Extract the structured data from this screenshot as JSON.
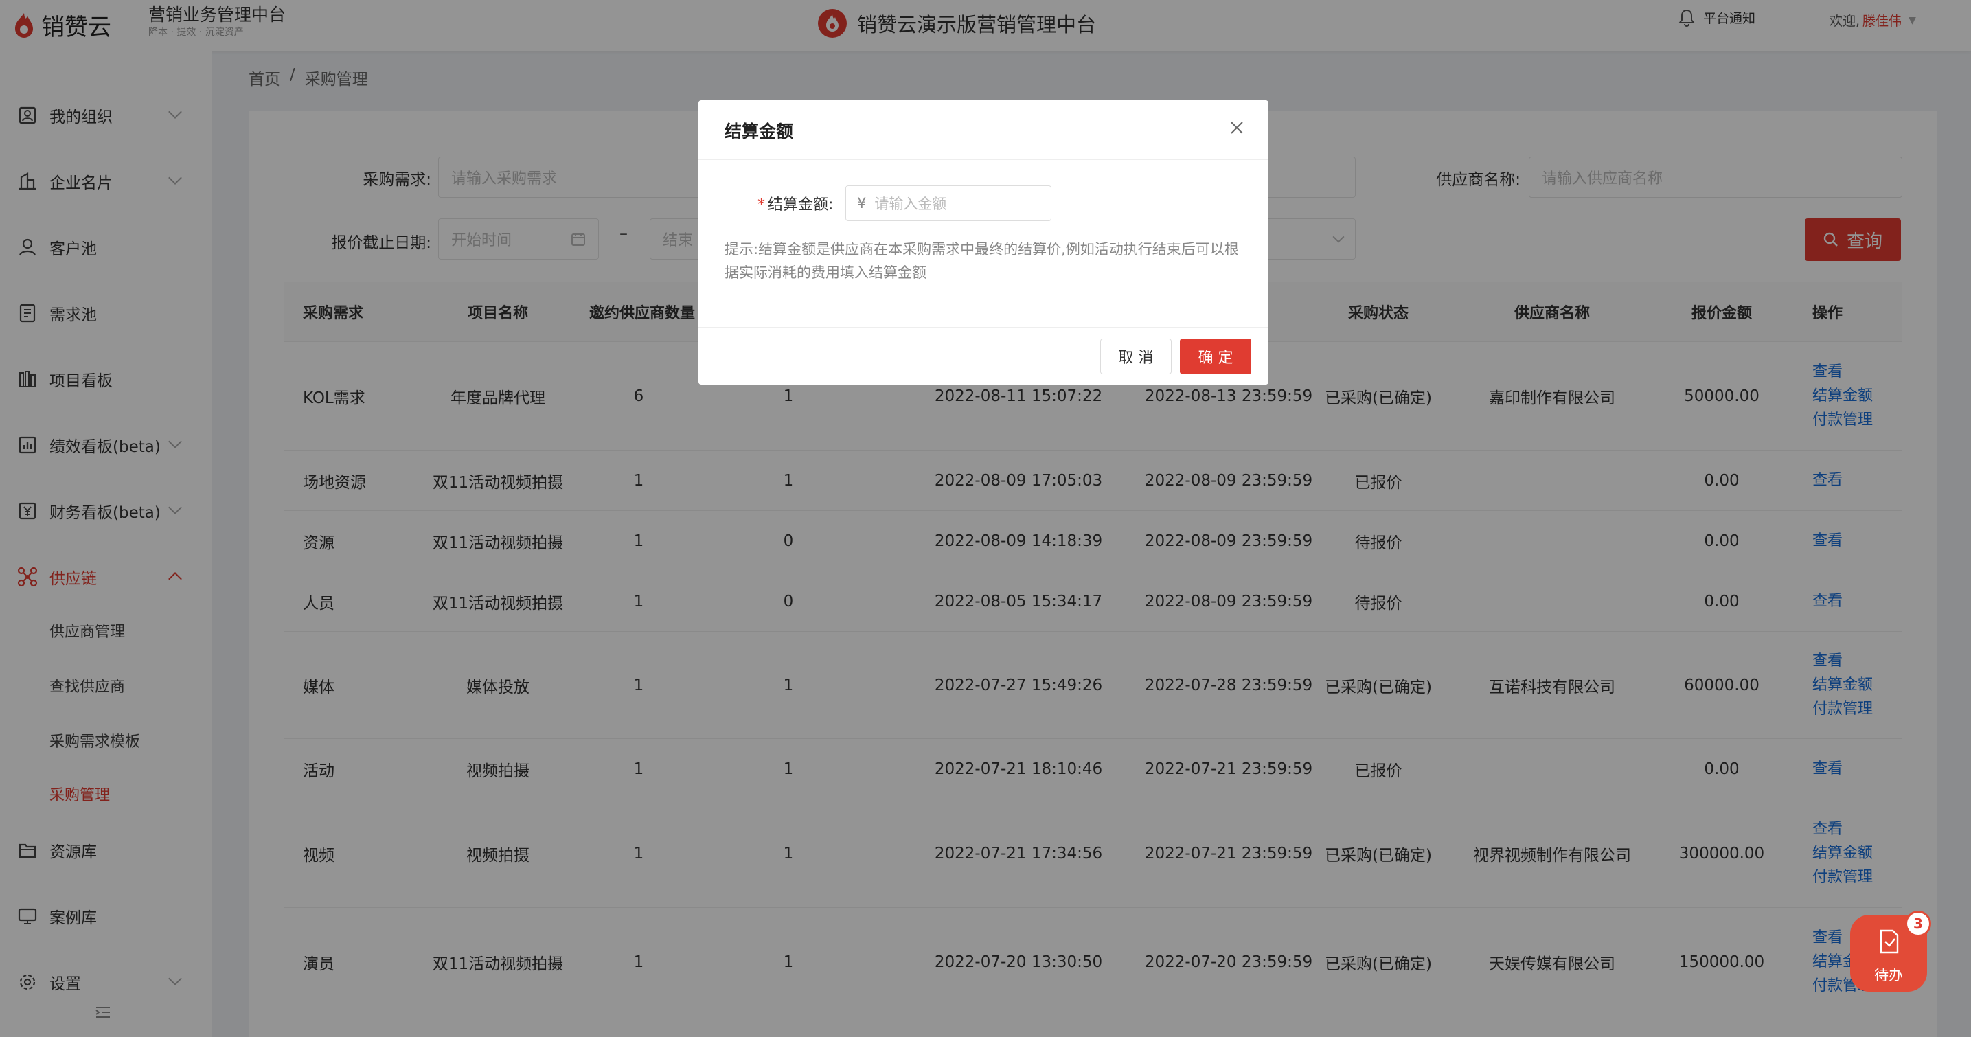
{
  "header": {
    "logo_text": "销赞云",
    "subtitle": "营销业务管理中台",
    "tagline": "降本 · 提效 · 沉淀资产",
    "center_title": "销赞云演示版营销管理中台",
    "notify_label": "平台通知",
    "welcome": "欢迎,",
    "user": "滕佳伟"
  },
  "sidebar": {
    "items": [
      {
        "label": "我的组织",
        "icon": "org-icon"
      },
      {
        "label": "企业名片",
        "icon": "building-icon"
      },
      {
        "label": "客户池",
        "icon": "user-icon"
      },
      {
        "label": "需求池",
        "icon": "list-icon"
      },
      {
        "label": "项目看板",
        "icon": "board-icon"
      },
      {
        "label": "绩效看板(beta)",
        "icon": "chart-icon"
      },
      {
        "label": "财务看板(beta)",
        "icon": "yen-icon"
      },
      {
        "label": "供应链",
        "icon": "supply-chain-icon"
      },
      {
        "label": "资源库",
        "icon": "folder-icon"
      },
      {
        "label": "案例库",
        "icon": "monitor-icon"
      },
      {
        "label": "设置",
        "icon": "gear-icon"
      }
    ],
    "sub_items": [
      "供应商管理",
      "查找供应商",
      "采购需求模板",
      "采购管理"
    ]
  },
  "breadcrumb": {
    "home": "首页",
    "sep": "/",
    "current": "采购管理"
  },
  "filters": {
    "demand_label": "采购需求:",
    "demand_placeholder": "请输入采购需求",
    "supplier_label": "供应商名称:",
    "supplier_placeholder": "请输入供应商名称",
    "date_label": "报价截止日期:",
    "start_placeholder": "开始时间",
    "end_placeholder": "结束",
    "dash": "–",
    "query": "查询"
  },
  "table": {
    "columns": [
      "采购需求",
      "项目名称",
      "邀约供应商数量",
      "采购状态",
      "供应商名称",
      "报价金额",
      "操作"
    ],
    "rows": [
      {
        "demand": "KOL需求",
        "project": "年度品牌代理",
        "invited": "6",
        "quoted": "1",
        "created": "2022-08-11 15:07:22",
        "deadline": "2022-08-13 23:59:59",
        "status": "已采购(已确定)",
        "supplier": "嘉印制作有限公司",
        "amount": "50000.00",
        "ops": [
          "查看",
          "结算金额",
          "付款管理"
        ]
      },
      {
        "demand": "场地资源",
        "project": "双11活动视频拍摄",
        "invited": "1",
        "quoted": "1",
        "created": "2022-08-09 17:05:03",
        "deadline": "2022-08-09 23:59:59",
        "status": "已报价",
        "supplier": "",
        "amount": "0.00",
        "ops": [
          "查看"
        ]
      },
      {
        "demand": "资源",
        "project": "双11活动视频拍摄",
        "invited": "1",
        "quoted": "0",
        "created": "2022-08-09 14:18:39",
        "deadline": "2022-08-09 23:59:59",
        "status": "待报价",
        "supplier": "",
        "amount": "0.00",
        "ops": [
          "查看"
        ]
      },
      {
        "demand": "人员",
        "project": "双11活动视频拍摄",
        "invited": "1",
        "quoted": "0",
        "created": "2022-08-05 15:34:17",
        "deadline": "2022-08-09 23:59:59",
        "status": "待报价",
        "supplier": "",
        "amount": "0.00",
        "ops": [
          "查看"
        ]
      },
      {
        "demand": "媒体",
        "project": "媒体投放",
        "invited": "1",
        "quoted": "1",
        "created": "2022-07-27 15:49:26",
        "deadline": "2022-07-28 23:59:59",
        "status": "已采购(已确定)",
        "supplier": "互诺科技有限公司",
        "amount": "60000.00",
        "ops": [
          "查看",
          "结算金额",
          "付款管理"
        ]
      },
      {
        "demand": "活动",
        "project": "视频拍摄",
        "invited": "1",
        "quoted": "1",
        "created": "2022-07-21 18:10:46",
        "deadline": "2022-07-21 23:59:59",
        "status": "已报价",
        "supplier": "",
        "amount": "0.00",
        "ops": [
          "查看"
        ]
      },
      {
        "demand": "视频",
        "project": "视频拍摄",
        "invited": "1",
        "quoted": "1",
        "created": "2022-07-21 17:34:56",
        "deadline": "2022-07-21 23:59:59",
        "status": "已采购(已确定)",
        "supplier": "视界视频制作有限公司",
        "amount": "300000.00",
        "ops": [
          "查看",
          "结算金额",
          "付款管理"
        ]
      },
      {
        "demand": "演员",
        "project": "双11活动视频拍摄",
        "invited": "1",
        "quoted": "1",
        "created": "2022-07-20 13:30:50",
        "deadline": "2022-07-20 23:59:59",
        "status": "已采购(已确定)",
        "supplier": "天娱传媒有限公司",
        "amount": "150000.00",
        "ops": [
          "查看",
          "结算金额",
          "付款管理"
        ]
      }
    ]
  },
  "modal": {
    "title": "结算金额",
    "required_mark": "*",
    "field_label": "结算金额:",
    "currency": "¥",
    "placeholder": "请输入金额",
    "hint": "提示:结算金额是供应商在本采购需求中最终的结算价,例如活动执行结束后可以根据实际消耗的费用填入结算金额",
    "cancel": "取 消",
    "confirm": "确 定"
  },
  "fab": {
    "badge": "3",
    "label": "待办"
  },
  "colors": {
    "accent": "#e03c31",
    "link": "#1a6fd8"
  }
}
